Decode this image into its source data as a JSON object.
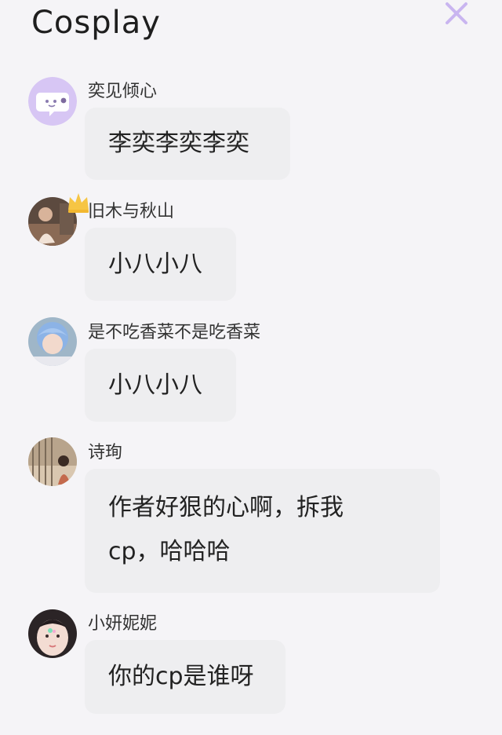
{
  "header": {
    "title": "Cosplay",
    "close_icon": "close-icon",
    "close_color": "#c9b5f0"
  },
  "messages": [
    {
      "username": "奕见倾心",
      "avatar_icon": "chat-bubble-avatar",
      "lines": [
        "李奕李奕李奕"
      ]
    },
    {
      "username": "旧木与秋山",
      "avatar_icon": "photo-avatar",
      "badge_icon": "crown-icon",
      "lines": [
        "小八小八"
      ]
    },
    {
      "username": "是不吃香菜不是吃香菜",
      "avatar_icon": "photo-avatar",
      "lines": [
        "小八小八"
      ]
    },
    {
      "username": "诗珣",
      "avatar_icon": "photo-avatar",
      "lines": [
        "作者好狠的心啊，拆我",
        "cp，哈哈哈"
      ]
    },
    {
      "username": "小妍妮妮",
      "avatar_icon": "photo-avatar",
      "lines": [
        "你的cp是谁呀"
      ]
    }
  ],
  "colors": {
    "background": "#f5f4f7",
    "bubble": "#eeeef0",
    "crown": "#f6c544"
  }
}
